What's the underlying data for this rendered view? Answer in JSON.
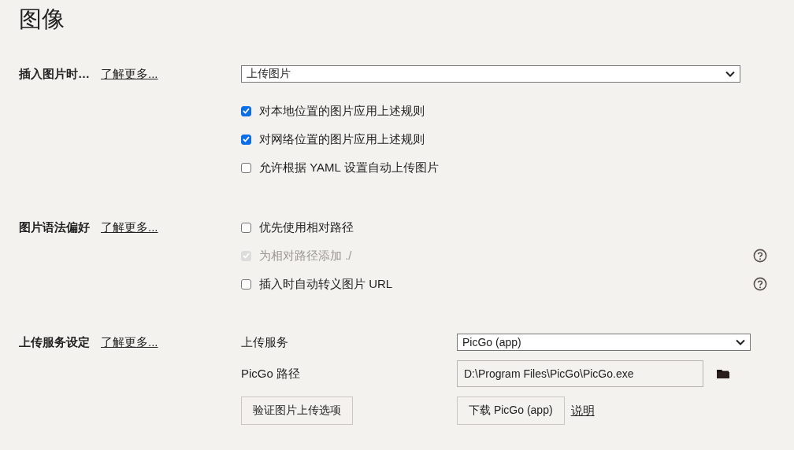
{
  "title": "图像",
  "sections": [
    {
      "kind": "insert",
      "label": "插入图片时…",
      "link": "了解更多...",
      "dropdown": {
        "value": "上传图片"
      },
      "options": [
        {
          "label": "对本地位置的图片应用上述规则",
          "checked": true,
          "disabled": false,
          "help": false
        },
        {
          "label": "对网络位置的图片应用上述规则",
          "checked": true,
          "disabled": false,
          "help": false
        },
        {
          "label": "允许根据 YAML 设置自动上传图片",
          "checked": false,
          "disabled": false,
          "help": false
        }
      ]
    },
    {
      "kind": "syntax",
      "label": "图片语法偏好",
      "link": "了解更多...",
      "options": [
        {
          "label": "优先使用相对路径",
          "checked": false,
          "disabled": false,
          "help": false
        },
        {
          "label": "为相对路径添加 ./",
          "checked": true,
          "disabled": true,
          "help": true
        },
        {
          "label": "插入时自动转义图片 URL",
          "checked": false,
          "disabled": false,
          "help": true
        }
      ]
    },
    {
      "kind": "upload",
      "label": "上传服务设定",
      "link": "了解更多...",
      "service_label": "上传服务",
      "service": {
        "value": "PicGo (app)"
      },
      "path_label": "PicGo 路径",
      "path": {
        "value": "D:\\Program Files\\PicGo\\PicGo.exe"
      },
      "verify_button": "验证图片上传选项",
      "download_button": "下载 PicGo (app)",
      "help_link": "说明"
    }
  ]
}
